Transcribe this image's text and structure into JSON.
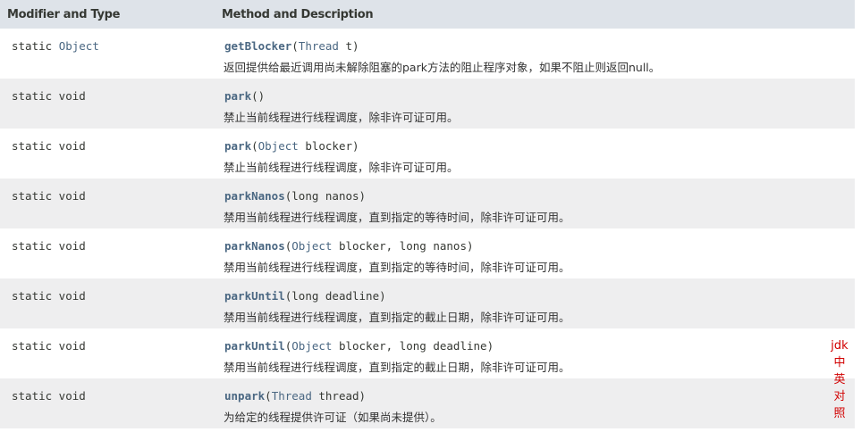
{
  "header": {
    "col1": "Modifier and Type",
    "col2": "Method and Description"
  },
  "rows": [
    {
      "mod_prefix": "static ",
      "mod_type": "Object",
      "method": "getBlocker",
      "params": [
        {
          "type": "Thread",
          "type_is_link": true,
          "name": "t"
        }
      ],
      "desc": "返回提供给最近调用尚未解除阻塞的park方法的阻止程序对象，如果不阻止则返回null。"
    },
    {
      "mod_prefix": "static void",
      "mod_type": "",
      "method": "park",
      "params": [],
      "desc": "禁止当前线程进行线程调度，除非许可证可用。"
    },
    {
      "mod_prefix": "static void",
      "mod_type": "",
      "method": "park",
      "params": [
        {
          "type": "Object",
          "type_is_link": true,
          "name": "blocker"
        }
      ],
      "desc": "禁止当前线程进行线程调度，除非许可证可用。"
    },
    {
      "mod_prefix": "static void",
      "mod_type": "",
      "method": "parkNanos",
      "params": [
        {
          "type": "long",
          "type_is_link": false,
          "name": "nanos"
        }
      ],
      "desc": "禁用当前线程进行线程调度，直到指定的等待时间，除非许可证可用。"
    },
    {
      "mod_prefix": "static void",
      "mod_type": "",
      "method": "parkNanos",
      "params": [
        {
          "type": "Object",
          "type_is_link": true,
          "name": "blocker"
        },
        {
          "type": "long",
          "type_is_link": false,
          "name": "nanos"
        }
      ],
      "desc": "禁用当前线程进行线程调度，直到指定的等待时间，除非许可证可用。"
    },
    {
      "mod_prefix": "static void",
      "mod_type": "",
      "method": "parkUntil",
      "params": [
        {
          "type": "long",
          "type_is_link": false,
          "name": "deadline"
        }
      ],
      "desc": "禁用当前线程进行线程调度，直到指定的截止日期，除非许可证可用。"
    },
    {
      "mod_prefix": "static void",
      "mod_type": "",
      "method": "parkUntil",
      "params": [
        {
          "type": "Object",
          "type_is_link": true,
          "name": "blocker"
        },
        {
          "type": "long",
          "type_is_link": false,
          "name": "deadline"
        }
      ],
      "desc": "禁用当前线程进行线程调度，直到指定的截止日期，除非许可证可用。"
    },
    {
      "mod_prefix": "static void",
      "mod_type": "",
      "method": "unpark",
      "params": [
        {
          "type": "Thread",
          "type_is_link": true,
          "name": "thread"
        }
      ],
      "desc": "为给定的线程提供许可证（如果尚未提供）。"
    }
  ],
  "side_label": [
    "jdk",
    "中",
    "英",
    "对",
    "照"
  ],
  "colors": {
    "header_bg": "#dee3e9",
    "row_alt_bg": "#eeeeef",
    "link": "#4a6782",
    "side_label": "#d10000"
  }
}
